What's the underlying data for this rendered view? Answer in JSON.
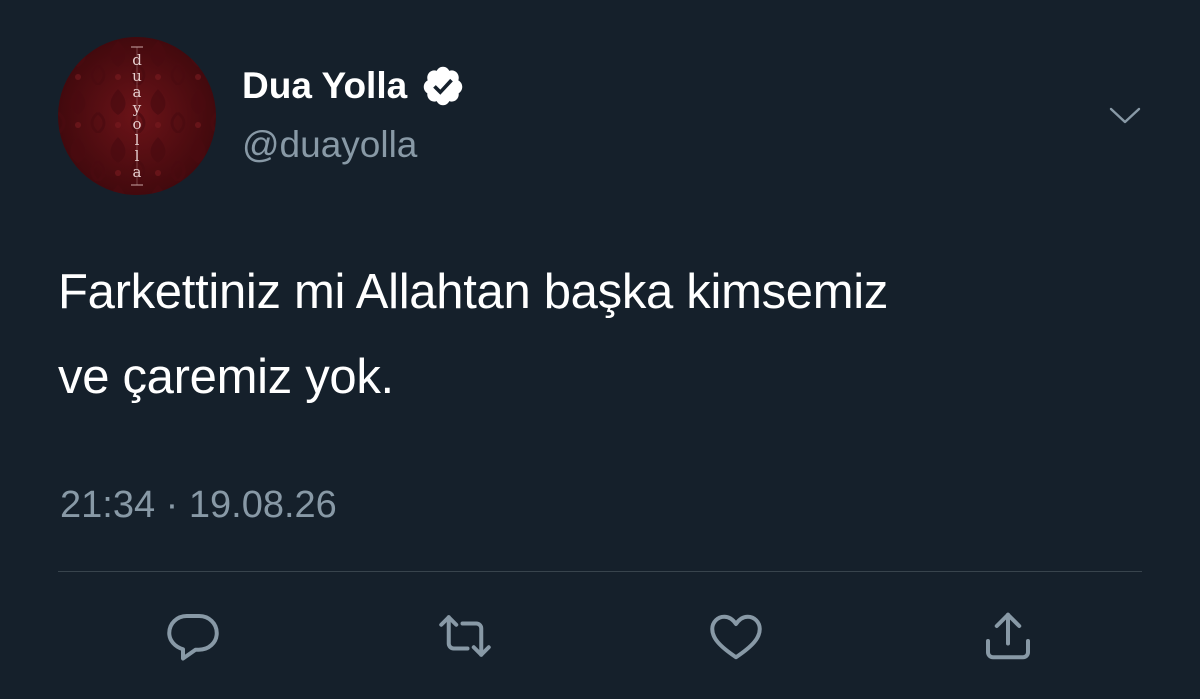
{
  "author": {
    "display_name": "Dua Yolla",
    "handle": "@duayolla",
    "verified": true,
    "avatar_text": "duayolla"
  },
  "tweet": {
    "text_line1": "Farkettiniz mi Allahtan başka kimsemiz",
    "text_line2": "ve çaremiz yok.",
    "time": "21:34",
    "separator": "·",
    "date": "19.08.26"
  },
  "icons": {
    "menu": "chevron-down-icon",
    "reply": "reply-icon",
    "retweet": "retweet-icon",
    "like": "heart-icon",
    "share": "share-icon",
    "verified": "verified-badge-icon"
  },
  "colors": {
    "background": "#15202b",
    "secondary_text": "#8899a6",
    "icon": "#8899a6",
    "divider": "#38444d",
    "avatar": "#5a0f14"
  }
}
